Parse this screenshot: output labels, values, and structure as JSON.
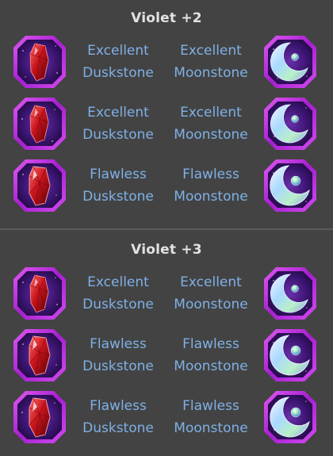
{
  "sections": [
    {
      "title": "Violet +2",
      "rows": [
        {
          "left": {
            "grade": "Excellent",
            "stone": "Duskstone"
          },
          "right": {
            "grade": "Excellent",
            "stone": "Moonstone"
          }
        },
        {
          "left": {
            "grade": "Excellent",
            "stone": "Duskstone"
          },
          "right": {
            "grade": "Excellent",
            "stone": "Moonstone"
          }
        },
        {
          "left": {
            "grade": "Flawless",
            "stone": "Duskstone"
          },
          "right": {
            "grade": "Flawless",
            "stone": "Moonstone"
          }
        }
      ]
    },
    {
      "title": "Violet +3",
      "rows": [
        {
          "left": {
            "grade": "Excellent",
            "stone": "Duskstone"
          },
          "right": {
            "grade": "Excellent",
            "stone": "Moonstone"
          }
        },
        {
          "left": {
            "grade": "Flawless",
            "stone": "Duskstone"
          },
          "right": {
            "grade": "Flawless",
            "stone": "Moonstone"
          }
        },
        {
          "left": {
            "grade": "Flawless",
            "stone": "Duskstone"
          },
          "right": {
            "grade": "Flawless",
            "stone": "Moonstone"
          }
        }
      ]
    }
  ],
  "icons": {
    "left": "duskstone-gem-icon",
    "right": "moonstone-gem-icon"
  },
  "colors": {
    "background": "#434343",
    "heading": "#e2e2e2",
    "label": "#7fb0e6",
    "frame": "#b12ad6"
  }
}
